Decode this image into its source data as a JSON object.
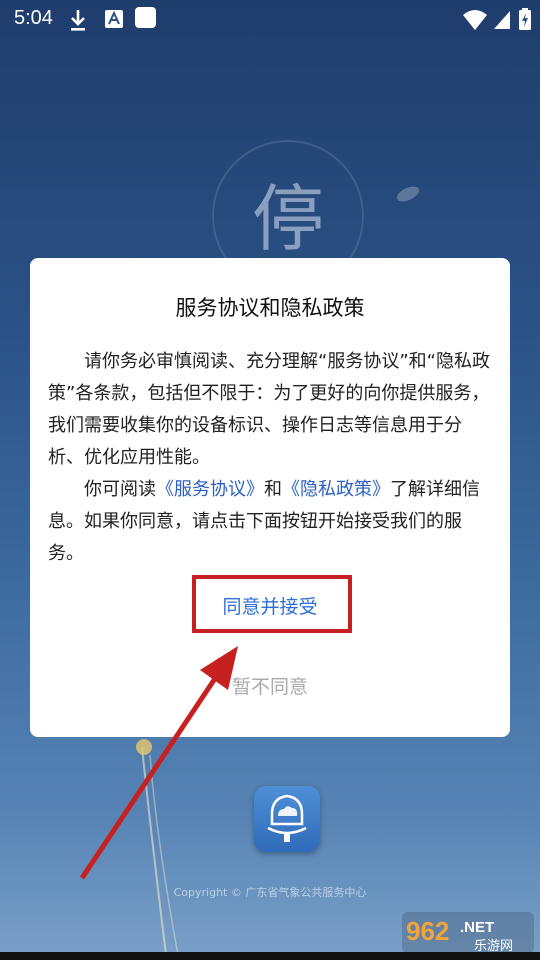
{
  "status_bar": {
    "time": "5:04"
  },
  "background": {
    "title_char": "停",
    "copyright": "Copyright © 广东省气象公共服务中心"
  },
  "dialog": {
    "title": "服务协议和隐私政策",
    "para1": "请你务必审慎阅读、充分理解“服务协议”和“隐私政策”各条款，包括但不限于：为了更好的向你提供服务，我们需要收集你的设备标识、操作日志等信息用于分析、优化应用性能。",
    "para2_prefix": "你可阅读",
    "link_service": "《服务协议》",
    "para2_and": "和",
    "link_privacy": "《隐私政策》",
    "para2_suffix": "了解详细信息。如果你同意，请点击下面按钮开始接受我们的服务。",
    "accept_label": "同意并接受",
    "decline_label": "暂不同意"
  },
  "watermark": {
    "brand": "962",
    "net": ".NET",
    "sub": "乐游网"
  },
  "colors": {
    "accent": "#2d6fd6",
    "annotation": "#c62020"
  }
}
